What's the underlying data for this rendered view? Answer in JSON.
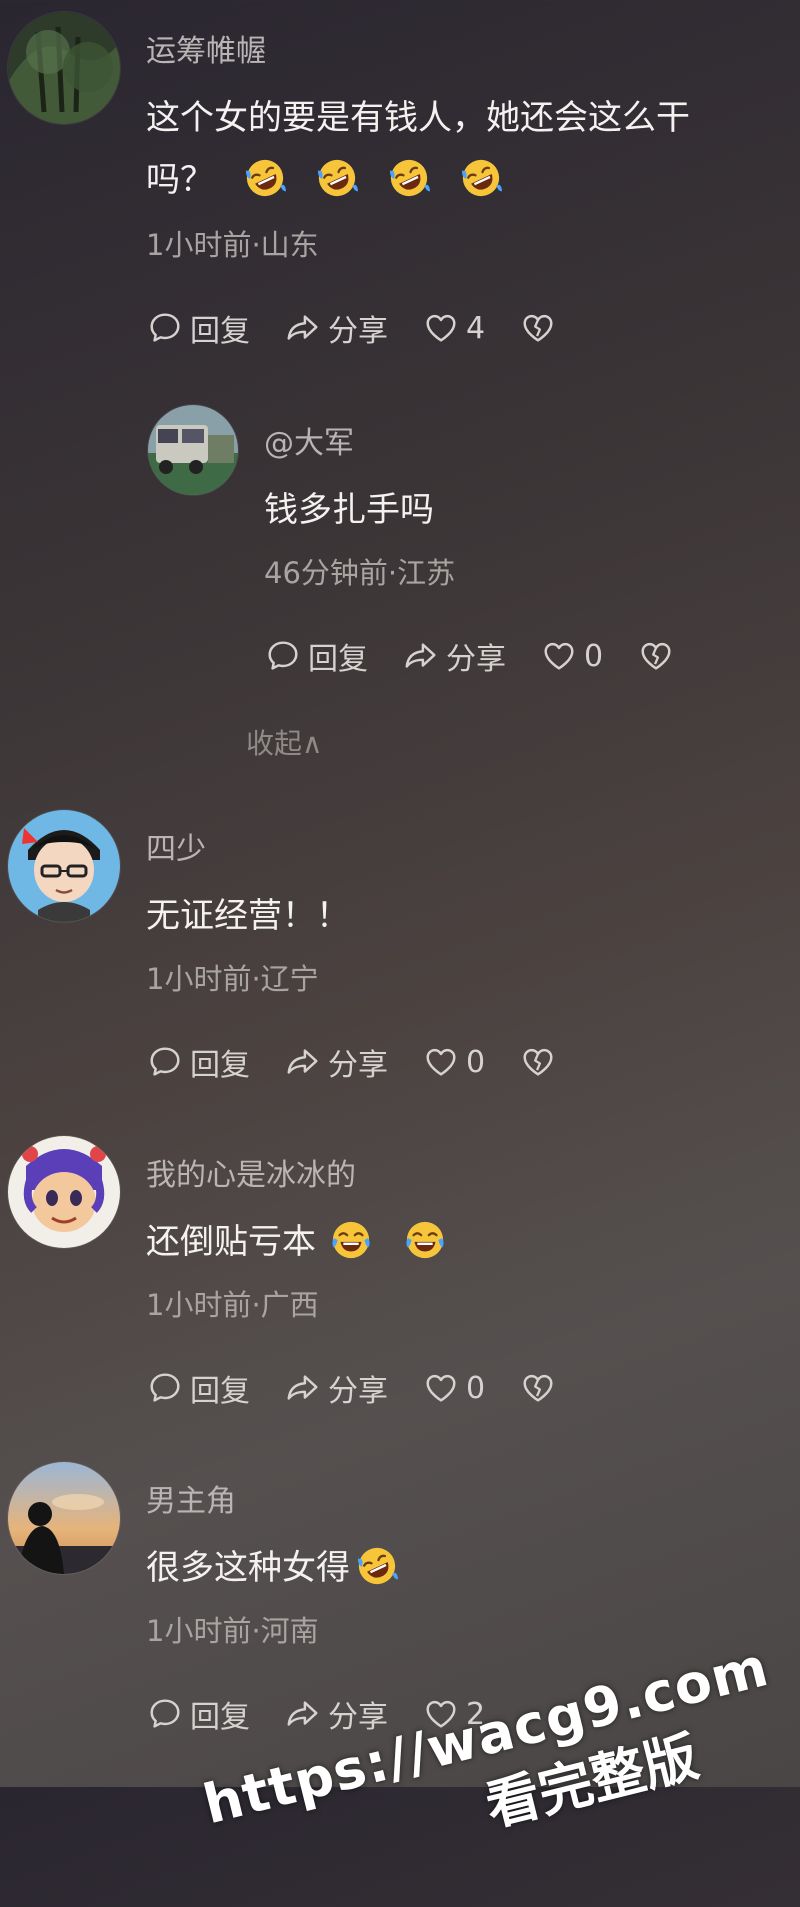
{
  "comments": [
    {
      "user": "运筹帷幄",
      "text_line1": "这个女的要是有钱人，她还会这么干",
      "text_line2": "吗？",
      "meta": "1小时前·山东",
      "reply_label": "回复",
      "share_label": "分享",
      "likes": "4",
      "reply": {
        "user": "@大军",
        "text": "钱多扎手吗",
        "meta": "46分钟前·江苏",
        "reply_label": "回复",
        "share_label": "分享",
        "likes": "0"
      },
      "collapse_label": "收起∧"
    },
    {
      "user": "四少",
      "text": "无证经营！！",
      "meta": "1小时前·辽宁",
      "reply_label": "回复",
      "share_label": "分享",
      "likes": "0"
    },
    {
      "user": "我的心是冰冰的",
      "text": "还倒贴亏本",
      "meta": "1小时前·广西",
      "reply_label": "回复",
      "share_label": "分享",
      "likes": "0"
    },
    {
      "user": "男主角",
      "text": "很多这种女得",
      "meta": "1小时前·河南",
      "reply_label": "回复",
      "share_label": "分享",
      "likes": "2"
    }
  ],
  "watermark": {
    "url": "https://wacg9.com",
    "subtitle": "看完整版"
  },
  "colors": {
    "emoji_face": "#f7c53a",
    "emoji_tear": "#4aa3ff"
  }
}
